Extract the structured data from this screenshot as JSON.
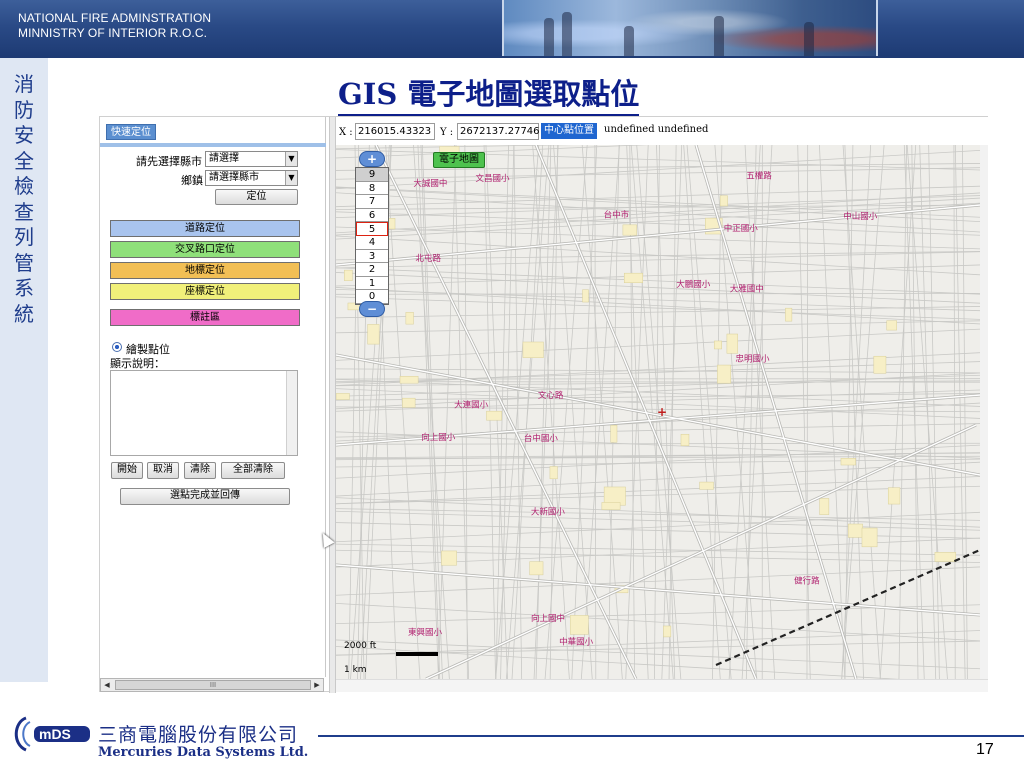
{
  "header": {
    "org_line1": "NATIONAL FIRE ADMINSTRATION",
    "org_line2": "MINNISTRY OF INTERIOR R.O.C."
  },
  "sidebar": {
    "vertical_title": [
      "消",
      "防",
      "安",
      "全",
      "檢",
      "查",
      "列",
      "管",
      "系",
      "統"
    ]
  },
  "slide": {
    "title": "GIS 電子地圖選取點位",
    "page_number": "17"
  },
  "panel": {
    "tab_label": "快速定位",
    "county_label": "請先選擇縣市",
    "county_value": "請選擇",
    "town_label": "鄉鎮",
    "town_value": "請選擇縣市",
    "locate_button": "定位",
    "mode_buttons": [
      {
        "label": "道路定位",
        "color": "#a9c4ee"
      },
      {
        "label": "交叉路口定位",
        "color": "#8fe07a"
      },
      {
        "label": "地標定位",
        "color": "#f2bf55"
      },
      {
        "label": "座標定位",
        "color": "#f1f07a"
      },
      {
        "label": "標註區",
        "color": "#f06cc8"
      }
    ],
    "radio_label": "繪製點位",
    "description_label": "顯示說明：",
    "buttons": {
      "start": "開始",
      "cancel": "取消",
      "clear": "清除",
      "clear_all": "全部清除"
    },
    "finish_button": "選點完成並回傳",
    "scroll_thumb": "III"
  },
  "map_toolbar": {
    "x_label": "X :",
    "x_value": "216015.43323",
    "y_label": "Y :",
    "y_value": "2672137.27746",
    "center_button": "中心點位置",
    "info_text": "undefined undefined"
  },
  "map": {
    "electronic_map_button": "電子地圖",
    "zoom_levels": [
      "9",
      "8",
      "7",
      "6",
      "5",
      "4",
      "3",
      "2",
      "1",
      "0"
    ],
    "selected_zoom": "5",
    "scale_ft": "2000 ft",
    "scale_km": "1 km",
    "labels": [
      "台中市",
      "大鵬國小",
      "東興國小",
      "大雅國中",
      "向上國中",
      "大新國小",
      "忠明國小",
      "中山國小",
      "文昌國小",
      "健行路",
      "五權路",
      "北屯路",
      "中華國小",
      "大誠國中",
      "台中國小",
      "中正國小",
      "文心路",
      "大連國小",
      "向上國小"
    ]
  },
  "footer": {
    "company_cn": "三商電腦股份有限公司",
    "company_en": "Mercuries Data Systems Ltd."
  }
}
